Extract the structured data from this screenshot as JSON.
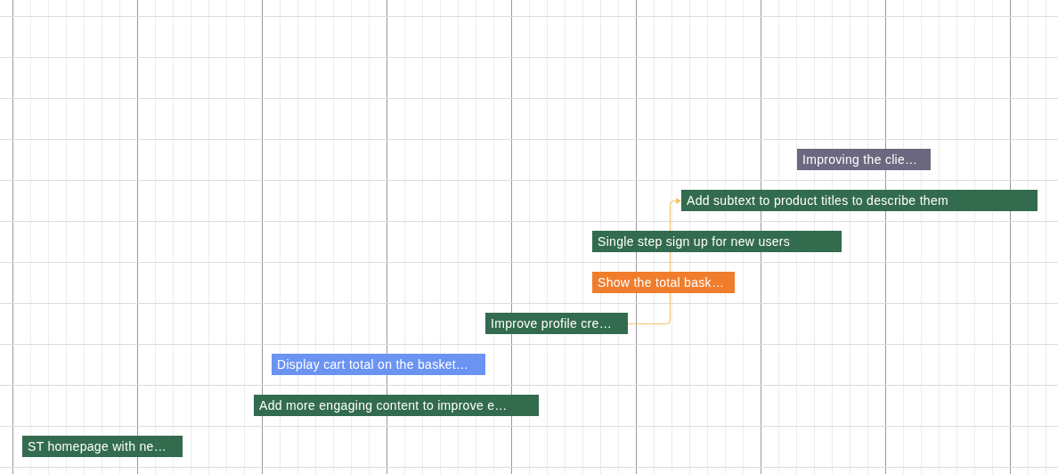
{
  "bars": [
    {
      "label": "Improving the clie…",
      "color": "#6b6880"
    },
    {
      "label": "Add subtext to product titles to describe them",
      "color": "#336b4e"
    },
    {
      "label": "Single step sign up for new users",
      "color": "#336b4e"
    },
    {
      "label": "Show the total bask…",
      "color": "#ef7d2c"
    },
    {
      "label": "Improve profile cre…",
      "color": "#336b4e"
    },
    {
      "label": "Display cart total on the basket…",
      "color": "#6b93f2"
    },
    {
      "label": "Add more engaging content to improve e…",
      "color": "#336b4e"
    },
    {
      "label": "ST homepage with ne…",
      "color": "#336b4e"
    }
  ]
}
